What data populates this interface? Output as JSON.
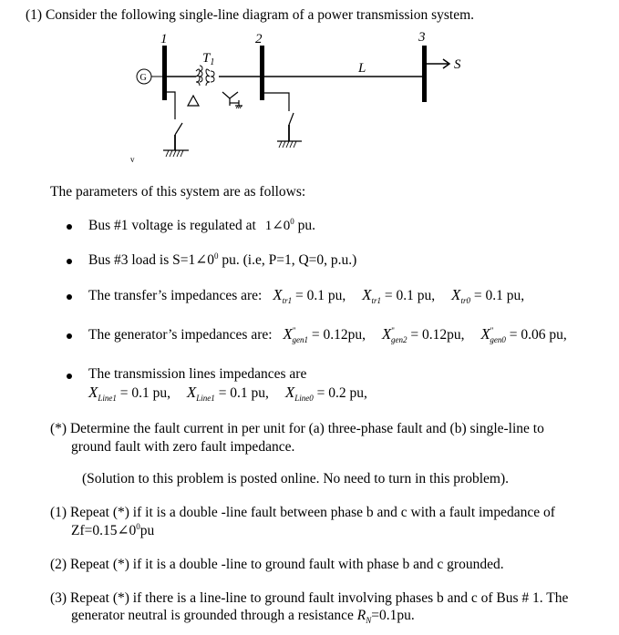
{
  "heading": "(1) Consider the following single-line diagram of a power transmission system.",
  "diagram": {
    "bus_labels": [
      "1",
      "2",
      "3"
    ],
    "transformer_label": "T",
    "transformer_sub": "1",
    "generator_label": "G",
    "line_label": "L",
    "load_label": "S",
    "stray_mark": "v",
    "transformer_primary": "delta",
    "transformer_secondary": "grounded-wye"
  },
  "params_intro": "The parameters of this system are as follows:",
  "bullets": {
    "b1": {
      "text": "Bus #1 voltage is regulated at",
      "value": "1∠0",
      "sup": "0",
      "unit": "pu."
    },
    "b2": {
      "text": "Bus #3  load is S=1∠0",
      "sup": "0",
      "rest": "pu.  (i.e,  P=1, Q=0, p.u.)"
    },
    "b3": {
      "text": "The transfer’s impedances are:",
      "items": [
        {
          "sym": "X",
          "sub": "tr1",
          "val": "= 0.1 pu,"
        },
        {
          "sym": "X",
          "sub": "tr1",
          "val": "= 0.1 pu,"
        },
        {
          "sym": "X",
          "sub": "tr0",
          "val": "= 0.1 pu,"
        }
      ]
    },
    "b4": {
      "text": "The generator’s impedances are:",
      "items": [
        {
          "sym": "X",
          "sup": "\"",
          "sub": "gen1",
          "val": "= 0.12pu,"
        },
        {
          "sym": "X",
          "sup": "\"",
          "sub": "gen2",
          "val": "= 0.12pu,"
        },
        {
          "sym": "X",
          "sup": "\"",
          "sub": "gen0",
          "val": "= 0.06 pu,"
        }
      ]
    },
    "b5": {
      "text": "The transmission lines impedances are",
      "items": [
        {
          "sym": "X",
          "sub": "Line1",
          "val": "= 0.1 pu,"
        },
        {
          "sym": "X",
          "sub": "Line1",
          "val": "= 0.1 pu,"
        },
        {
          "sym": "X",
          "sub": "Line0",
          "val": "= 0.2 pu,"
        }
      ]
    }
  },
  "star": {
    "line1": "(*)  Determine the fault current in per unit for (a) three-phase fault and (b) single-line to",
    "line2": "ground fault with zero fault impedance.",
    "note": "(Solution to this problem is posted online.  No need to turn in this problem)."
  },
  "q1": {
    "line1": "(1) Repeat (*) if it is a double -line fault between phase b and c with a fault impedance of",
    "line2_pre": "Zf=0.15∠0",
    "line2_sup": "0",
    "line2_post": "pu"
  },
  "q2": {
    "line1": "(2) Repeat (*) if it is a double -line to ground fault with phase b and c grounded."
  },
  "q3": {
    "line1": "(3) Repeat (*) if there is a line-line to ground fault involving phases b and c of Bus # 1.  The",
    "line2_pre": "generator neutral is grounded through a resistance",
    "rn_sym": "R",
    "rn_sub": "N",
    "line2_post": "=0.1pu."
  }
}
